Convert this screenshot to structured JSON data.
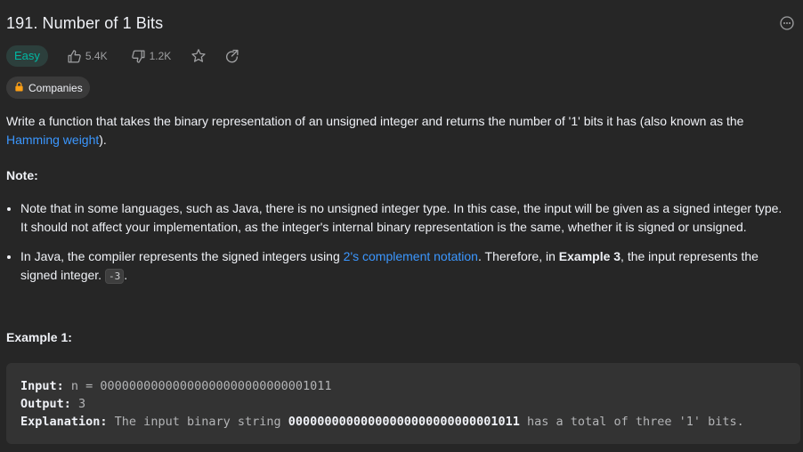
{
  "problem": {
    "title": "191. Number of 1 Bits",
    "difficulty": "Easy",
    "likes": "5.4K",
    "dislikes": "1.2K",
    "companies_label": "Companies"
  },
  "description": {
    "intro_text": "Write a function that takes the binary representation of an unsigned integer and returns the number of '1' bits it has (also known as the ",
    "intro_link": "Hamming weight",
    "intro_end": ").",
    "note_heading": "Note:",
    "note1": "Note that in some languages, such as Java, there is no unsigned integer type. In this case, the input will be given as a signed integer type. It should not affect your implementation, as the integer's internal binary representation is the same, whether it is signed or unsigned.",
    "note2_start": "In Java, the compiler represents the signed integers using ",
    "note2_link": "2's complement notation",
    "note2_mid": ". Therefore, in ",
    "note2_bold": "Example 3",
    "note2_end": ", the input represents the signed integer. ",
    "note2_code": "-3",
    "note2_tail": "."
  },
  "example1": {
    "heading": "Example 1:",
    "input_label": "Input:",
    "input_value": " n = 00000000000000000000000000001011",
    "output_label": "Output:",
    "output_value": " 3",
    "explanation_label": "Explanation:",
    "explanation_start": " The input binary string ",
    "explanation_bold": "00000000000000000000000000001011",
    "explanation_end": " has a total of three '1' bits."
  },
  "icons": {
    "more": "more-options-icon",
    "like": "thumbs-up-icon",
    "dislike": "thumbs-down-icon",
    "favorite": "star-icon",
    "share": "share-icon",
    "lock": "lock-icon"
  },
  "colors": {
    "background": "#262626",
    "easy": "#00b8a3",
    "link": "#3b97ff",
    "lock": "#ffa116"
  }
}
